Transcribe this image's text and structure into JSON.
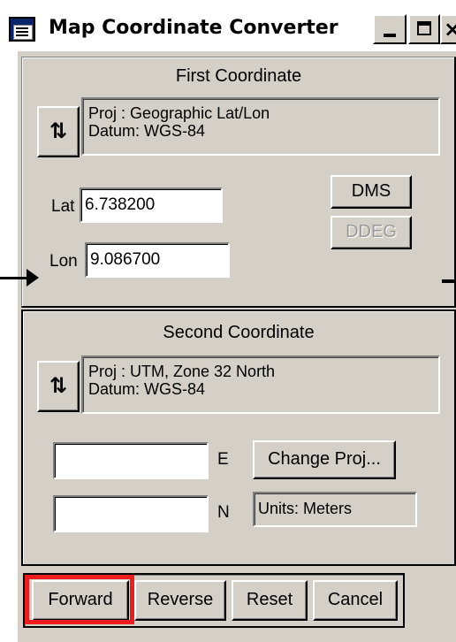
{
  "window": {
    "title": "Map Coordinate Converter",
    "close_glyph": "×"
  },
  "first": {
    "heading": "First Coordinate",
    "swap_glyph": "⇅",
    "proj_line": "Proj : Geographic Lat/Lon",
    "datum_line": "Datum: WGS-84",
    "lat_label": "Lat",
    "lat_value": "6.738200",
    "lon_label": "Lon",
    "lon_value": "9.086700",
    "dms_label": "DMS",
    "ddeg_label": "DDEG"
  },
  "second": {
    "heading": "Second Coordinate",
    "swap_glyph": "⇅",
    "proj_line": "Proj : UTM, Zone 32 North",
    "datum_line": "Datum: WGS-84",
    "e_label": "E",
    "e_value": "",
    "n_label": "N",
    "n_value": "",
    "change_proj_label": "Change Proj...",
    "units_text": "Units: Meters"
  },
  "actions": {
    "forward": "Forward",
    "reverse": "Reverse",
    "reset": "Reset",
    "cancel": "Cancel"
  },
  "colors": {
    "face": "#d4d0c8",
    "highlight_frame": "#ee1c1c"
  },
  "icons": {
    "app": "app-window-icon",
    "swap": "swap-arrows-icon",
    "pointer": "annotation-arrow-icon"
  }
}
